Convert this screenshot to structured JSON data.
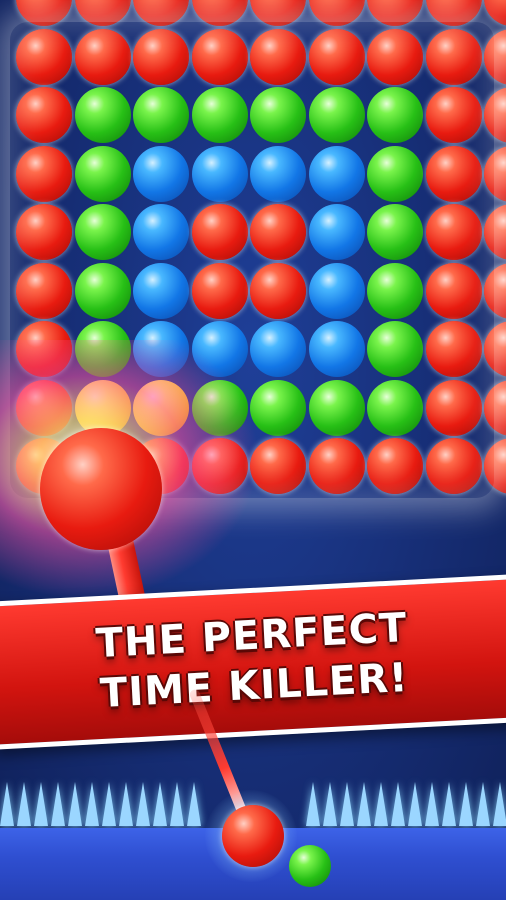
{
  "banner": {
    "line1": "THE PERFECT",
    "line2": "TIME KILLER!"
  },
  "colors": {
    "red": "#e81b10",
    "green": "#27c016",
    "blue": "#1276e6",
    "yellow": "#f1c21c",
    "background": "#162d74",
    "banner": "#d2140f",
    "floor": "#2f4fd1"
  },
  "board": {
    "rows": [
      [
        "red",
        "red",
        "red",
        "red",
        "red",
        "red",
        "red",
        "red",
        "red"
      ],
      [
        "red",
        "red",
        "red",
        "red",
        "red",
        "red",
        "red",
        "red",
        "red"
      ],
      [
        "red",
        "green",
        "green",
        "green",
        "green",
        "green",
        "green",
        "red",
        "red"
      ],
      [
        "red",
        "green",
        "blue",
        "blue",
        "blue",
        "blue",
        "green",
        "red",
        "red"
      ],
      [
        "red",
        "green",
        "blue",
        "red",
        "red",
        "blue",
        "green",
        "red",
        "red"
      ],
      [
        "red",
        "green",
        "blue",
        "red",
        "red",
        "blue",
        "green",
        "red",
        "red"
      ],
      [
        "red",
        "green",
        "blue",
        "blue",
        "blue",
        "blue",
        "green",
        "red",
        "red"
      ],
      [
        "red",
        "yellow",
        "yellow",
        "green",
        "green",
        "green",
        "green",
        "red",
        "red"
      ],
      [
        "red",
        "red",
        "red",
        "red",
        "red",
        "red",
        "red",
        "red",
        "red"
      ]
    ]
  },
  "shooter": {
    "current_color": "red",
    "next_color": "green"
  }
}
